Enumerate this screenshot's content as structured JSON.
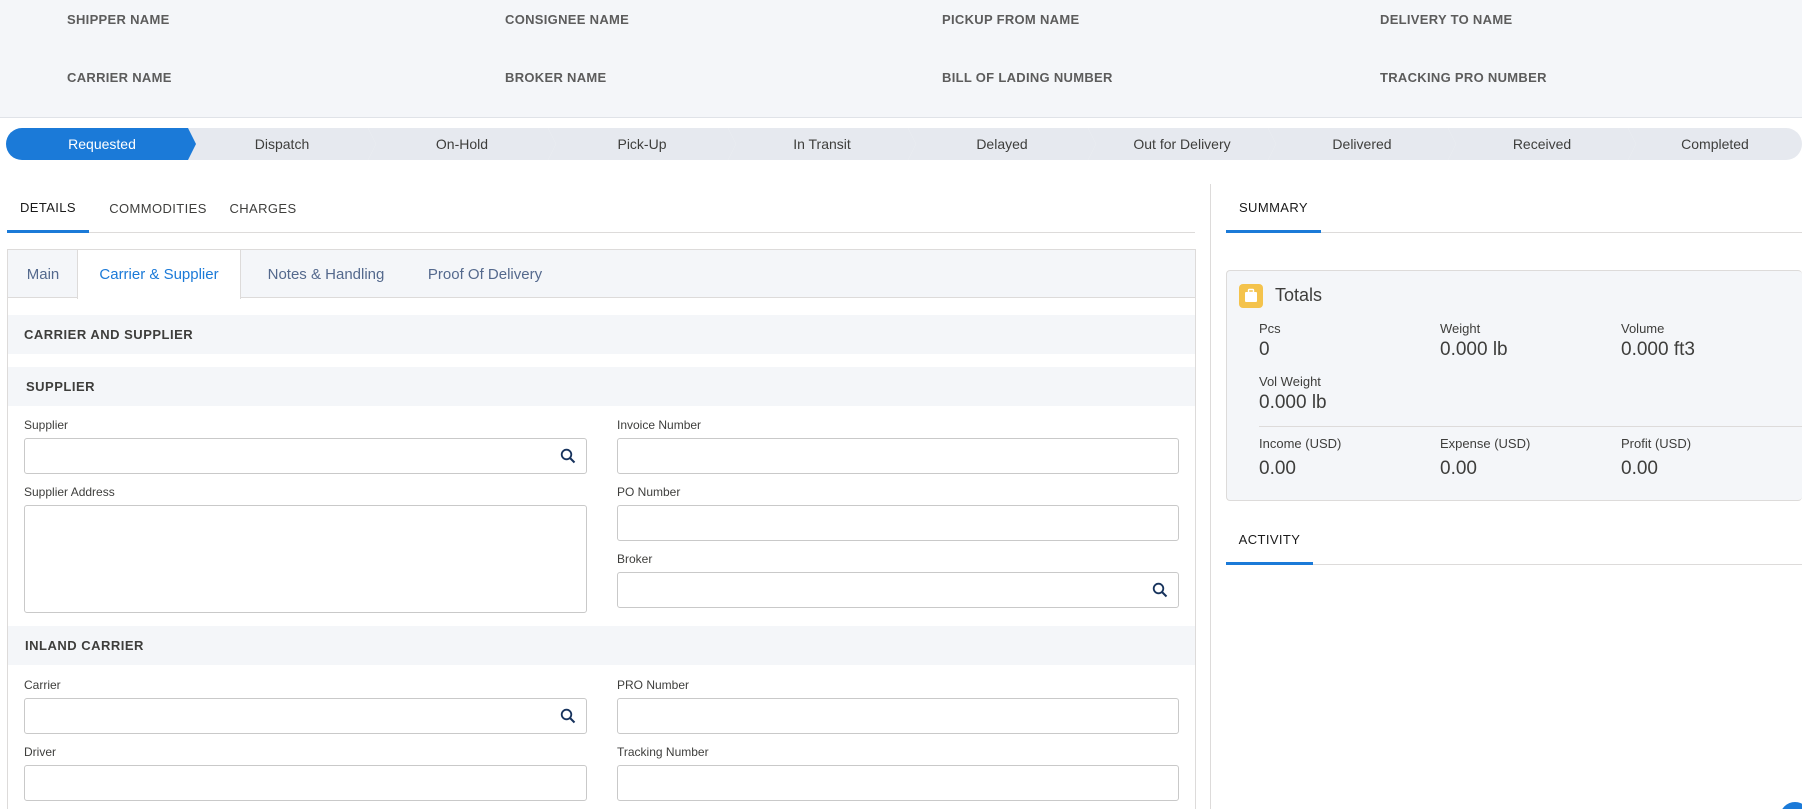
{
  "header": {
    "shipper_name": "SHIPPER NAME",
    "consignee_name": "CONSIGNEE NAME",
    "pickup_from_name": "PICKUP FROM NAME",
    "delivery_to_name": "DELIVERY TO NAME",
    "carrier_name": "CARRIER NAME",
    "broker_name": "BROKER NAME",
    "bill_of_lading_number": "BILL OF LADING NUMBER",
    "tracking_pro_number": "TRACKING PRO NUMBER"
  },
  "path": {
    "active": "Requested",
    "steps": [
      "Requested",
      "Dispatch",
      "On-Hold",
      "Pick-Up",
      "In Transit",
      "Delayed",
      "Out for Delivery",
      "Delivered",
      "Received",
      "Completed"
    ]
  },
  "main_tabs": {
    "active": "DETAILS",
    "items": [
      "DETAILS",
      "COMMODITIES",
      "CHARGES"
    ]
  },
  "sub_tabs": {
    "active": "Carrier & Supplier",
    "items": [
      "Main",
      "Carrier & Supplier",
      "Notes & Handling",
      "Proof Of Delivery"
    ]
  },
  "sections": {
    "carrier_and_supplier": "CARRIER AND SUPPLIER",
    "supplier": "SUPPLIER",
    "inland_carrier": "INLAND CARRIER"
  },
  "fields": {
    "supplier": {
      "label": "Supplier",
      "value": ""
    },
    "invoice_number": {
      "label": "Invoice Number",
      "value": ""
    },
    "supplier_address": {
      "label": "Supplier Address",
      "value": ""
    },
    "po_number": {
      "label": "PO Number",
      "value": ""
    },
    "broker": {
      "label": "Broker",
      "value": ""
    },
    "carrier": {
      "label": "Carrier",
      "value": ""
    },
    "pro_number": {
      "label": "PRO Number",
      "value": ""
    },
    "driver": {
      "label": "Driver",
      "value": ""
    },
    "tracking_number": {
      "label": "Tracking Number",
      "value": ""
    }
  },
  "summary": {
    "tab_label": "SUMMARY",
    "totals_title": "Totals",
    "pcs": {
      "label": "Pcs",
      "value": "0"
    },
    "weight": {
      "label": "Weight",
      "value": "0.000 lb"
    },
    "volume": {
      "label": "Volume",
      "value": "0.000 ft3"
    },
    "vol_weight": {
      "label": "Vol Weight",
      "value": "0.000 lb"
    },
    "income": {
      "label": "Income (USD)",
      "value": "0.00"
    },
    "expense": {
      "label": "Expense (USD)",
      "value": "0.00"
    },
    "profit": {
      "label": "Profit (USD)",
      "value": "0.00"
    }
  },
  "activity": {
    "tab_label": "ACTIVITY"
  },
  "colors": {
    "accent": "#1b7ad8",
    "totals_icon": "#f4c34c"
  }
}
